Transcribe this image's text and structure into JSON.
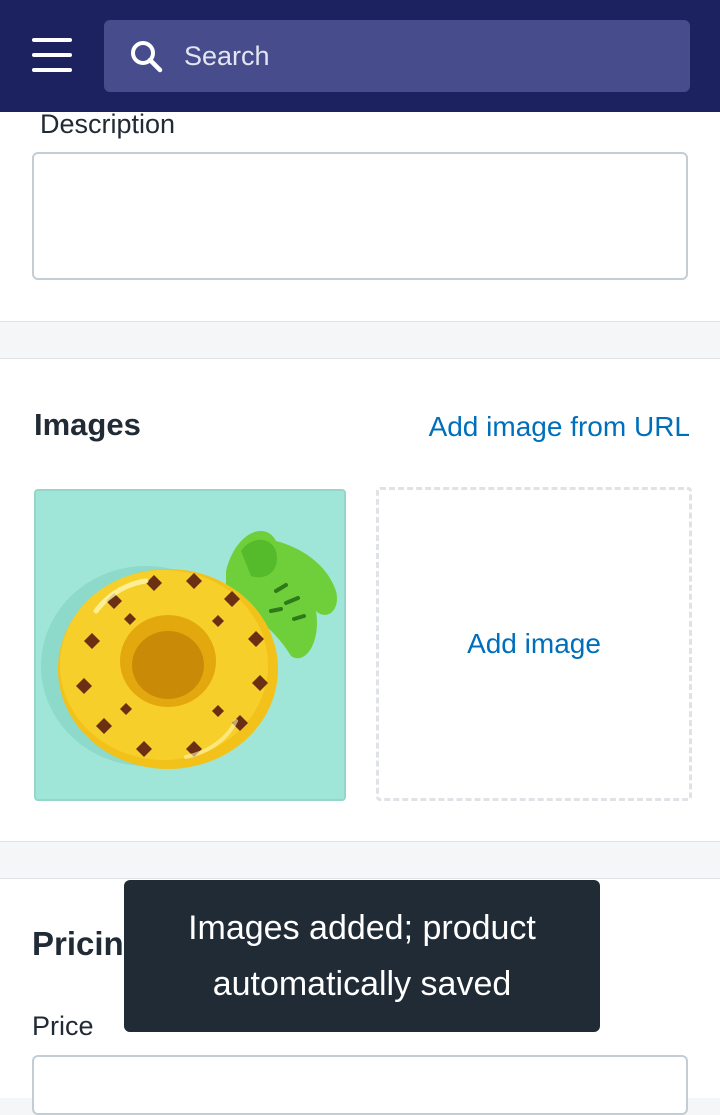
{
  "topbar": {
    "menu_icon": "hamburger-menu-icon",
    "search": {
      "placeholder": "Search",
      "icon": "search-icon"
    }
  },
  "description": {
    "label": "Description",
    "value": ""
  },
  "images": {
    "title": "Images",
    "add_from_url_label": "Add image from URL",
    "add_image_label": "Add image",
    "thumbnails": [
      {
        "subject": "inflatable pineapple drink float"
      }
    ]
  },
  "pricing": {
    "title": "Pricing",
    "price_label": "Price"
  },
  "toast": {
    "message": "Images added; product automatically saved"
  },
  "colors": {
    "topbar": "#1c2260",
    "search_bg": "#474d8c",
    "link": "#006fbb",
    "toast_bg": "#212b36",
    "image_bg": "#9fe6d8"
  }
}
